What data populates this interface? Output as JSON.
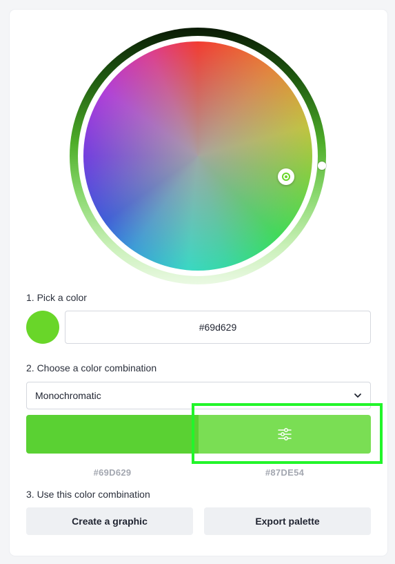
{
  "picker": {
    "step1_label": "1. Pick a color",
    "selected_hex": "#69d629",
    "swatch_color": "#69d629"
  },
  "combination": {
    "step2_label": "2. Choose a color combination",
    "selected": "Monochromatic",
    "colors": [
      {
        "hex_label": "#69D629",
        "color": "#5ad133"
      },
      {
        "hex_label": "#87DE54",
        "color": "#7ade54"
      }
    ]
  },
  "actions": {
    "step3_label": "3. Use this color combination",
    "create_label": "Create a graphic",
    "export_label": "Export palette"
  },
  "icons": {
    "dropdown": "chevron-down-icon",
    "adjust": "sliders-icon"
  },
  "highlight_color": "#22f52a"
}
